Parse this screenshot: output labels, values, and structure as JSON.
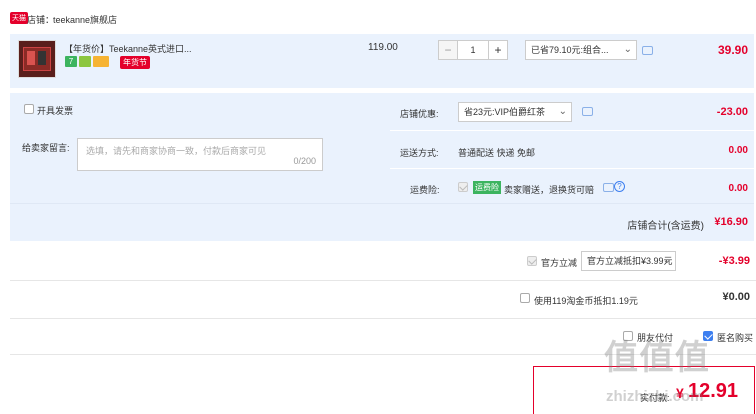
{
  "shop": {
    "badge": "天猫",
    "label": "店铺：",
    "name": "teekanne旗舰店"
  },
  "item": {
    "title": "【年货价】Teekanne英式进口...",
    "tag": "年货节",
    "price": "119.00",
    "quantity": "1",
    "minus": "−",
    "plus": "+",
    "promo_select": "已省79.10元:组合...",
    "subtotal": "39.90"
  },
  "invoice": {
    "label": "开具发票"
  },
  "message": {
    "label": "给卖家留言:",
    "placeholder": "选填，请先和商家协商一致，付款后商家可见",
    "counter": "0/200"
  },
  "shop_discount": {
    "label": "店铺优惠:",
    "select": "省23元:VIP伯爵红茶",
    "value": "-23.00"
  },
  "delivery": {
    "label": "运送方式:",
    "method": "普通配送 快递 免邮",
    "value": "0.00"
  },
  "insurance": {
    "label": "运费险:",
    "badge": "运费险",
    "text": "卖家赠送，退换货可赔",
    "help": "?",
    "value": "0.00"
  },
  "shop_total": {
    "label": "店铺合计(含运费)",
    "value": "¥16.90"
  },
  "tmall_discount": {
    "label": "官方立减",
    "select": "官方立减抵扣¥3.99元",
    "value": "-¥3.99"
  },
  "coins": {
    "label": "使用119淘金币抵扣1.19元",
    "value": "¥0.00"
  },
  "footer": {
    "anonymous": "匿名购买",
    "friend_pay": "朋友代付"
  },
  "actual": {
    "label": "实付款:",
    "currency": "¥",
    "amount": "12.91"
  },
  "watermark": {
    "big": "值 值 值",
    "url": "zhizhizhi.com"
  },
  "colors": {
    "accent": "#e4002b",
    "link_blue": "#3d7ff0",
    "section_bg": "#eaf2fd"
  }
}
